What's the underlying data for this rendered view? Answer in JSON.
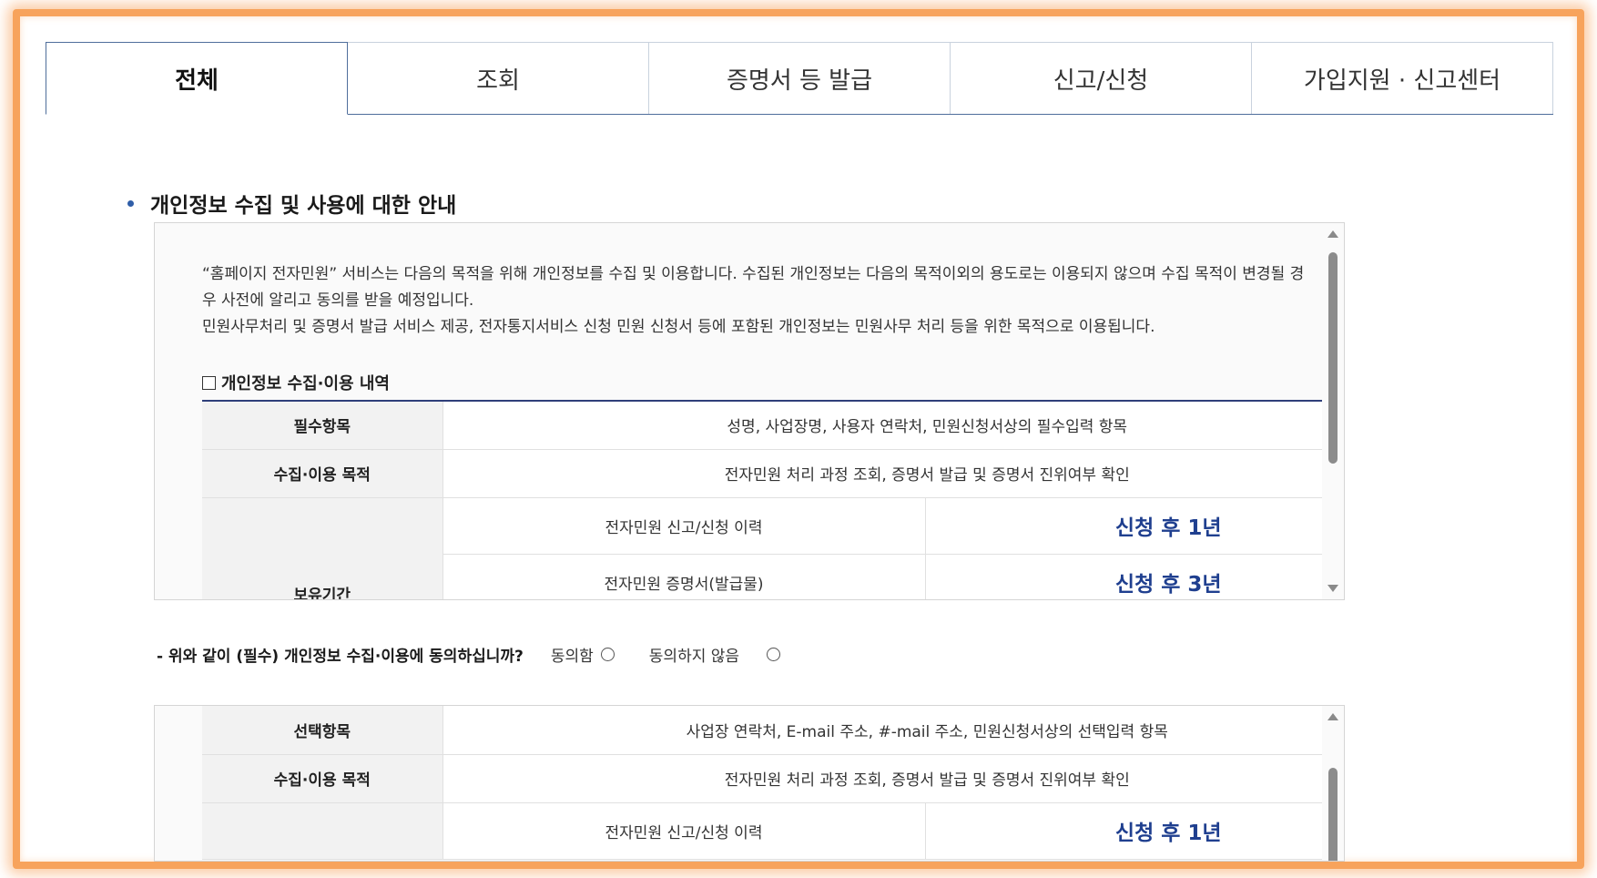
{
  "tabs": [
    {
      "label": "전체",
      "active": true
    },
    {
      "label": "조회",
      "active": false
    },
    {
      "label": "증명서 등 발급",
      "active": false
    },
    {
      "label": "신고/신청",
      "active": false
    },
    {
      "label": "가입지원 · 신고센터",
      "active": false
    }
  ],
  "section": {
    "title": "개인정보 수집 및 사용에 대한 안내"
  },
  "notice": {
    "line1": "“홈페이지 전자민원” 서비스는 다음의 목적을 위해 개인정보를 수집 및 이용합니다. 수집된 개인정보는 다음의 목적이외의 용도로는 이용되지 않으며 수집 목적이 변경될 경우 사전에 알리고 동의를 받을 예정입니다.",
    "line2": "민원사무처리 및 증명서 발급 서비스 제공, 전자통지서비스 신청 민원 신청서 등에 포함된 개인정보는 민원사무 처리 등을 위한 목적으로 이용됩니다.",
    "table_title": "개인정보 수집·이용 내역"
  },
  "required_table": {
    "rows": [
      {
        "head": "필수항목",
        "value": "성명, 사업장명, 사용자 연락처, 민원신청서상의 필수입력 항목"
      },
      {
        "head": "수집·이용 목적",
        "value": "전자민원 처리 과정 조회, 증명서 발급 및 증명서 진위여부 확인"
      }
    ],
    "retention_head": "보유기간",
    "retention": [
      {
        "item": "전자민원 신고/신청 이력",
        "period": "신청 후 1년"
      },
      {
        "item": "전자민원 증명서(발급물)",
        "period": "신청 후 3년"
      }
    ]
  },
  "consent": {
    "question": "- 위와 같이 (필수) 개인정보 수집·이용에 동의하십니까?",
    "agree": "동의함",
    "disagree": "동의하지 않음"
  },
  "optional_table": {
    "rows": [
      {
        "head": "선택항목",
        "value": "사업장 연락처, E-mail 주소, #-mail 주소, 민원신청서상의 선택입력 항목"
      },
      {
        "head": "수집·이용 목적",
        "value": "전자민원 처리 과정 조회, 증명서 발급 및 증명서 진위여부 확인"
      }
    ],
    "retention": [
      {
        "item": "전자민원 신고/신청 이력",
        "period": "신청 후 1년"
      }
    ]
  },
  "colors": {
    "frame": "#f7a35c",
    "accent": "#2f3f7a",
    "period_text": "#1f3f8f"
  }
}
